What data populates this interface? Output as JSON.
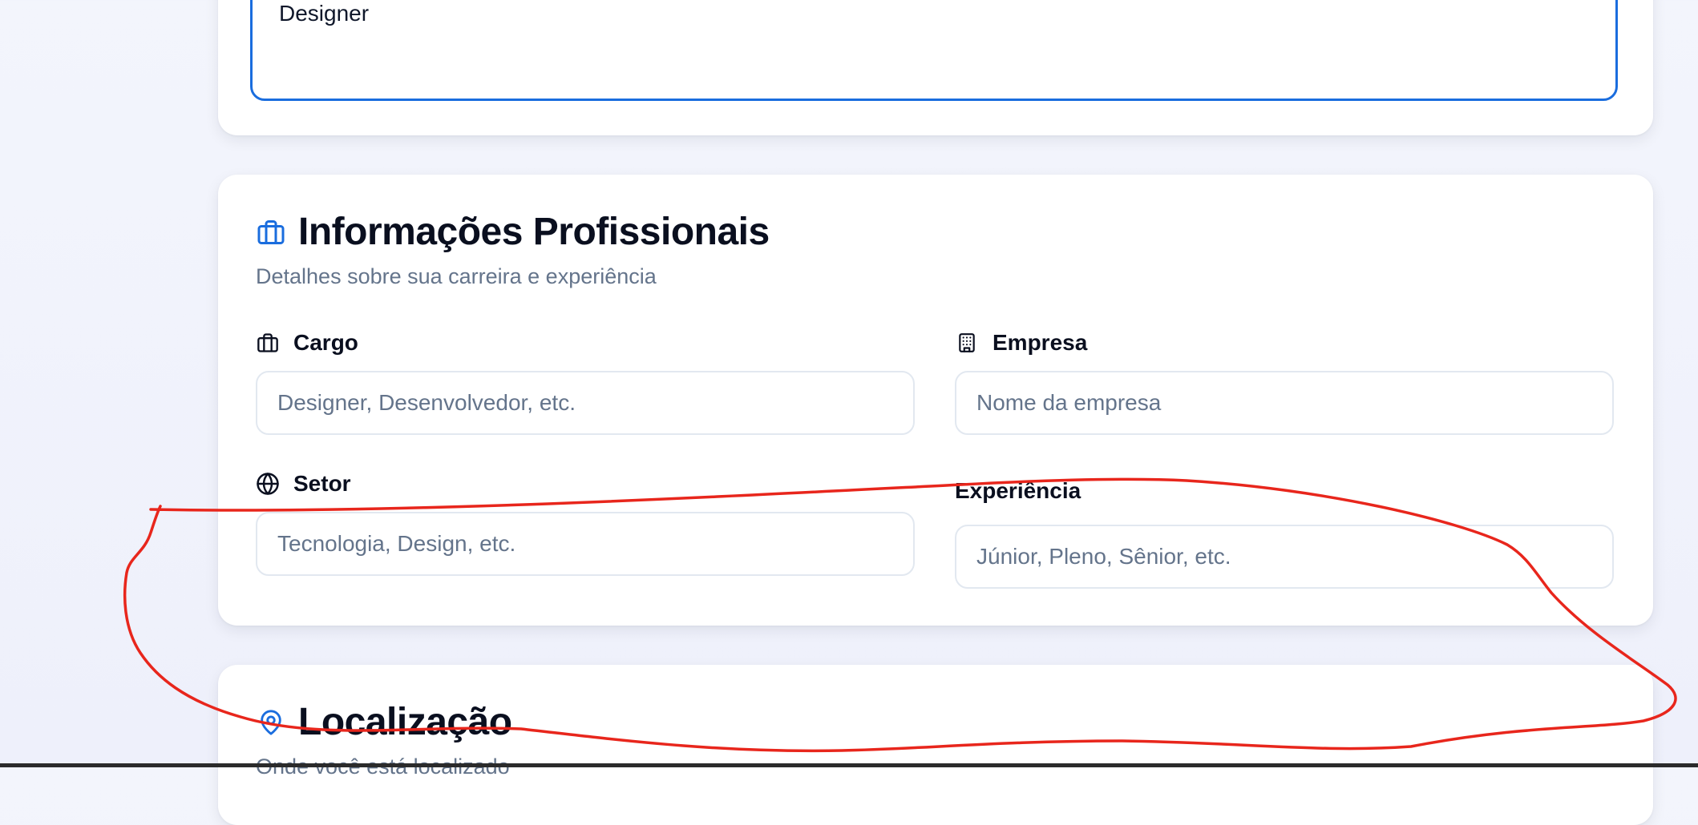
{
  "bio": {
    "value": "Designer"
  },
  "professional": {
    "title": "Informações Profissionais",
    "subtitle": "Detalhes sobre sua carreira e experiência",
    "fields": {
      "cargo": {
        "label": "Cargo",
        "placeholder": "Designer, Desenvolvedor, etc.",
        "icon": "briefcase-icon"
      },
      "empresa": {
        "label": "Empresa",
        "placeholder": "Nome da empresa",
        "icon": "building-icon"
      },
      "setor": {
        "label": "Setor",
        "placeholder": "Tecnologia, Design, etc.",
        "icon": "globe-icon"
      },
      "experiencia": {
        "label": "Experiência",
        "placeholder": "Júnior, Pleno, Sênior, etc."
      }
    },
    "icon": "briefcase-icon"
  },
  "location": {
    "title": "Localização",
    "subtitle": "Onde você está localizado",
    "icon": "map-pin-icon"
  },
  "colors": {
    "accent": "#1a6dde",
    "annotation": "#e8261c",
    "muted_text": "#64748b",
    "border": "#e2e8f0"
  }
}
